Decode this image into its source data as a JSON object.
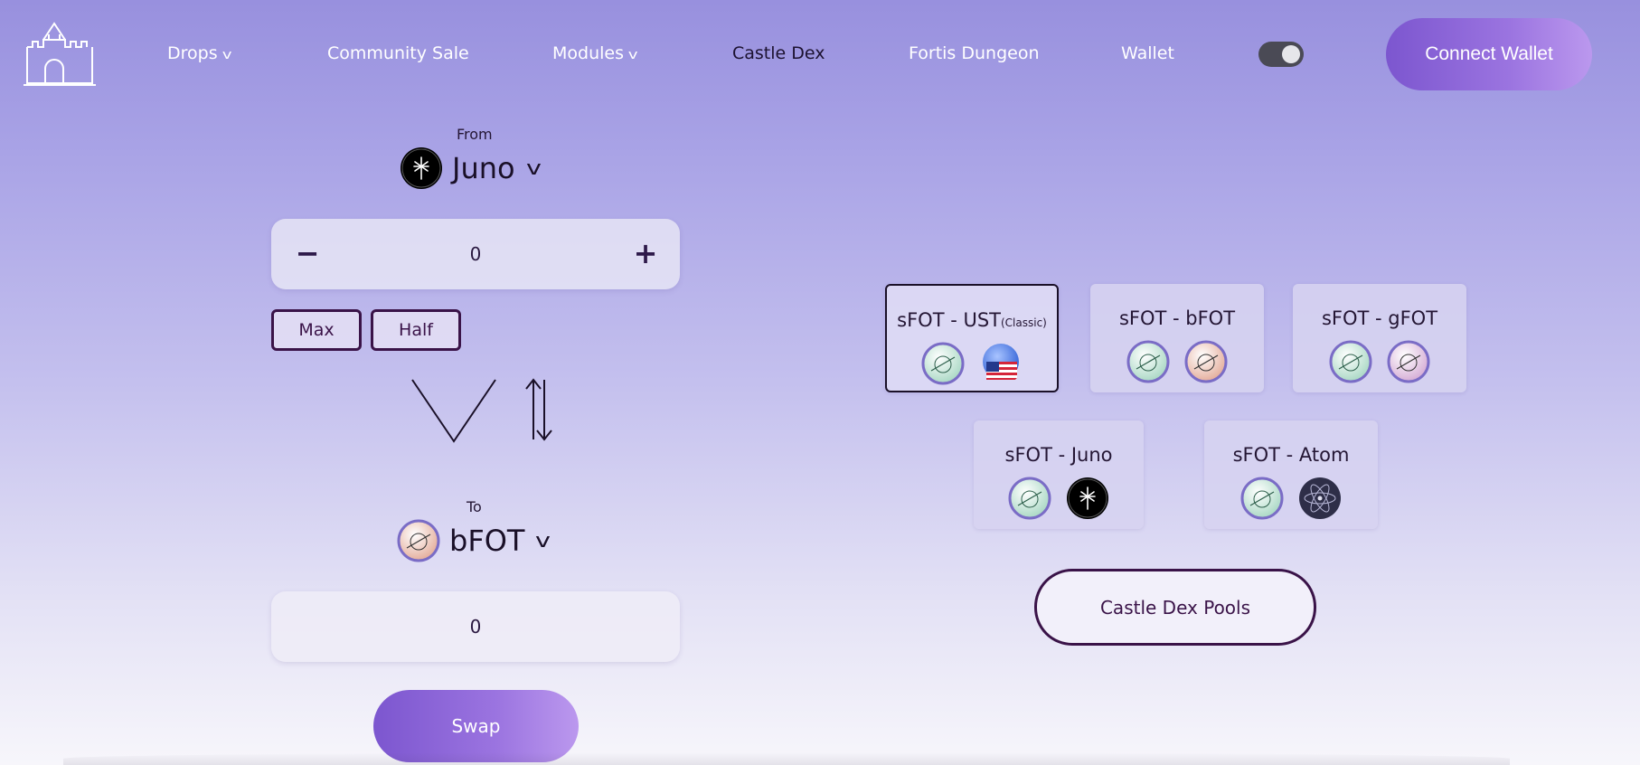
{
  "nav": {
    "links": [
      {
        "label": "Drops",
        "dropdown": true
      },
      {
        "label": "Community Sale",
        "dropdown": false
      },
      {
        "label": "Modules",
        "dropdown": true
      },
      {
        "label": "Castle Dex",
        "dropdown": false,
        "active": true
      },
      {
        "label": "Fortis Dungeon",
        "dropdown": false
      },
      {
        "label": "Wallet",
        "dropdown": false
      }
    ],
    "theme_toggle_on": true,
    "connect_label": "Connect Wallet",
    "chevron": "v"
  },
  "swap": {
    "from_label": "From",
    "from_token": "Juno",
    "from_amount": "0",
    "minus": "−",
    "plus": "+",
    "max_label": "Max",
    "half_label": "Half",
    "to_label": "To",
    "to_token": "bFOT",
    "to_amount": "0",
    "swap_label": "Swap"
  },
  "pools": {
    "cards": [
      {
        "title": "sFOT - UST",
        "suffix": "(Classic)",
        "icons": [
          "sfot-icon",
          "ust-icon"
        ],
        "selected": true
      },
      {
        "title": "sFOT - bFOT",
        "suffix": "",
        "icons": [
          "sfot-icon",
          "bfot-icon"
        ],
        "selected": false
      },
      {
        "title": "sFOT - gFOT",
        "suffix": "",
        "icons": [
          "sfot-icon",
          "gfot-icon"
        ],
        "selected": false
      },
      {
        "title": "sFOT - Juno",
        "suffix": "",
        "icons": [
          "sfot-icon",
          "juno-icon"
        ],
        "selected": false
      },
      {
        "title": "sFOT - Atom",
        "suffix": "",
        "icons": [
          "sfot-icon",
          "atom-icon"
        ],
        "selected": false
      }
    ],
    "pools_button": "Castle Dex Pools"
  },
  "colors": {
    "accent": "#8a64d8",
    "dark_border": "#3a1348",
    "sfot": "#a9d8c4",
    "bfot": "#e6b3a3",
    "gfot": "#d9b0d6",
    "juno": "#000000",
    "atom": "#2e2e48"
  }
}
